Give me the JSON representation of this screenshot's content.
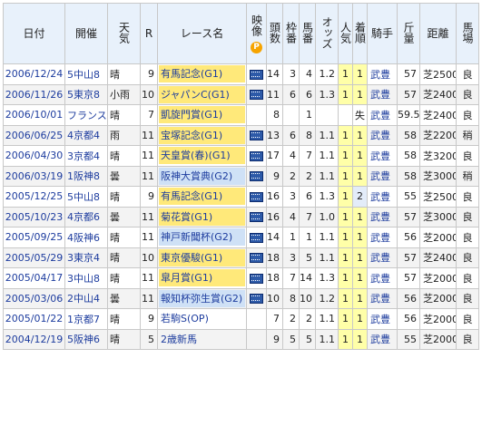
{
  "headers": {
    "date": "日付",
    "venue": "開催",
    "weather": "天気",
    "r": "R",
    "race": "レース名",
    "video": "映像",
    "video_badge": "P",
    "heads": "頭数",
    "gate": "枠番",
    "horse": "馬番",
    "odds": "オッズ",
    "pop": "人気",
    "finish": "着順",
    "jockey": "騎手",
    "weight": "斤量",
    "distance": "距離",
    "going": "馬場"
  },
  "rows": [
    {
      "date": "2006/12/24",
      "venue": "5中山8",
      "weather": "晴",
      "r": "9",
      "race": "有馬記念(G1)",
      "grade": "g1",
      "video": true,
      "heads": "14",
      "gate": "3",
      "horse": "4",
      "odds": "1.2",
      "pop": "1",
      "finish": "1",
      "jockey": "武豊",
      "weight": "57",
      "distance": "芝2500",
      "going": "良"
    },
    {
      "date": "2006/11/26",
      "venue": "5東京8",
      "weather": "小雨",
      "r": "10",
      "race": "ジャパンC(G1)",
      "grade": "g1",
      "video": true,
      "heads": "11",
      "gate": "6",
      "horse": "6",
      "odds": "1.3",
      "pop": "1",
      "finish": "1",
      "jockey": "武豊",
      "weight": "57",
      "distance": "芝2400",
      "going": "良"
    },
    {
      "date": "2006/10/01",
      "venue": "フランス",
      "weather": "晴",
      "r": "7",
      "race": "凱旋門賞(G1)",
      "grade": "g1",
      "video": false,
      "heads": "8",
      "gate": "",
      "horse": "1",
      "odds": "",
      "pop": "",
      "finish": "失",
      "jockey": "武豊",
      "weight": "59.5",
      "distance": "芝2400",
      "going": "良"
    },
    {
      "date": "2006/06/25",
      "venue": "4京都4",
      "weather": "雨",
      "r": "11",
      "race": "宝塚記念(G1)",
      "grade": "g1",
      "video": true,
      "heads": "13",
      "gate": "6",
      "horse": "8",
      "odds": "1.1",
      "pop": "1",
      "finish": "1",
      "jockey": "武豊",
      "weight": "58",
      "distance": "芝2200",
      "going": "稍"
    },
    {
      "date": "2006/04/30",
      "venue": "3京都4",
      "weather": "晴",
      "r": "11",
      "race": "天皇賞(春)(G1)",
      "grade": "g1",
      "video": true,
      "heads": "17",
      "gate": "4",
      "horse": "7",
      "odds": "1.1",
      "pop": "1",
      "finish": "1",
      "jockey": "武豊",
      "weight": "58",
      "distance": "芝3200",
      "going": "良"
    },
    {
      "date": "2006/03/19",
      "venue": "1阪神8",
      "weather": "曇",
      "r": "11",
      "race": "阪神大賞典(G2)",
      "grade": "g2",
      "video": true,
      "heads": "9",
      "gate": "2",
      "horse": "2",
      "odds": "1.1",
      "pop": "1",
      "finish": "1",
      "jockey": "武豊",
      "weight": "58",
      "distance": "芝3000",
      "going": "稍"
    },
    {
      "date": "2005/12/25",
      "venue": "5中山8",
      "weather": "晴",
      "r": "9",
      "race": "有馬記念(G1)",
      "grade": "g1",
      "video": true,
      "heads": "16",
      "gate": "3",
      "horse": "6",
      "odds": "1.3",
      "pop": "1",
      "finish": "2",
      "jockey": "武豊",
      "weight": "55",
      "distance": "芝2500",
      "going": "良"
    },
    {
      "date": "2005/10/23",
      "venue": "4京都6",
      "weather": "曇",
      "r": "11",
      "race": "菊花賞(G1)",
      "grade": "g1",
      "video": true,
      "heads": "16",
      "gate": "4",
      "horse": "7",
      "odds": "1.0",
      "pop": "1",
      "finish": "1",
      "jockey": "武豊",
      "weight": "57",
      "distance": "芝3000",
      "going": "良"
    },
    {
      "date": "2005/09/25",
      "venue": "4阪神6",
      "weather": "晴",
      "r": "11",
      "race": "神戸新聞杯(G2)",
      "grade": "g2",
      "video": true,
      "heads": "14",
      "gate": "1",
      "horse": "1",
      "odds": "1.1",
      "pop": "1",
      "finish": "1",
      "jockey": "武豊",
      "weight": "56",
      "distance": "芝2000",
      "going": "良"
    },
    {
      "date": "2005/05/29",
      "venue": "3東京4",
      "weather": "晴",
      "r": "10",
      "race": "東京優駿(G1)",
      "grade": "g1",
      "video": true,
      "heads": "18",
      "gate": "3",
      "horse": "5",
      "odds": "1.1",
      "pop": "1",
      "finish": "1",
      "jockey": "武豊",
      "weight": "57",
      "distance": "芝2400",
      "going": "良"
    },
    {
      "date": "2005/04/17",
      "venue": "3中山8",
      "weather": "晴",
      "r": "11",
      "race": "皐月賞(G1)",
      "grade": "g1",
      "video": true,
      "heads": "18",
      "gate": "7",
      "horse": "14",
      "odds": "1.3",
      "pop": "1",
      "finish": "1",
      "jockey": "武豊",
      "weight": "57",
      "distance": "芝2000",
      "going": "良"
    },
    {
      "date": "2005/03/06",
      "venue": "2中山4",
      "weather": "曇",
      "r": "11",
      "race": "報知杯弥生賞(G2)",
      "grade": "g2",
      "video": true,
      "heads": "10",
      "gate": "8",
      "horse": "10",
      "odds": "1.2",
      "pop": "1",
      "finish": "1",
      "jockey": "武豊",
      "weight": "56",
      "distance": "芝2000",
      "going": "良"
    },
    {
      "date": "2005/01/22",
      "venue": "1京都7",
      "weather": "晴",
      "r": "9",
      "race": "若駒S(OP)",
      "grade": "plain",
      "video": false,
      "heads": "7",
      "gate": "2",
      "horse": "2",
      "odds": "1.1",
      "pop": "1",
      "finish": "1",
      "jockey": "武豊",
      "weight": "56",
      "distance": "芝2000",
      "going": "良"
    },
    {
      "date": "2004/12/19",
      "venue": "5阪神6",
      "weather": "晴",
      "r": "5",
      "race": "2歳新馬",
      "grade": "plain",
      "video": false,
      "heads": "9",
      "gate": "5",
      "horse": "5",
      "odds": "1.1",
      "pop": "1",
      "finish": "1",
      "jockey": "武豊",
      "weight": "55",
      "distance": "芝2000",
      "going": "良"
    }
  ]
}
